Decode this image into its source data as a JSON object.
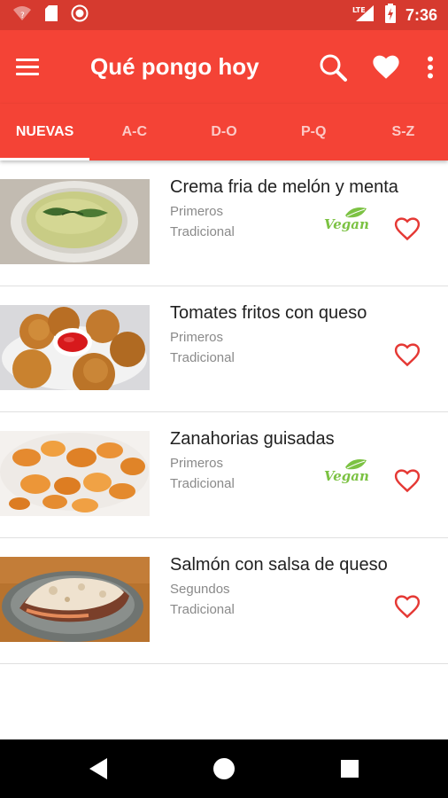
{
  "status_bar": {
    "time": "7:36",
    "network_label": "LTE",
    "icons": [
      "wifi-question-icon",
      "sd-card-icon",
      "record-icon",
      "cell-signal-icon",
      "battery-charging-icon"
    ]
  },
  "app_bar": {
    "title": "Qué pongo hoy",
    "icons": [
      "menu-icon",
      "search-icon",
      "heart-icon",
      "more-vert-icon"
    ]
  },
  "tabs": [
    {
      "label": "NUEVAS",
      "active": true
    },
    {
      "label": "A-C",
      "active": false
    },
    {
      "label": "D-O",
      "active": false
    },
    {
      "label": "P-Q",
      "active": false
    },
    {
      "label": "S-Z",
      "active": false
    }
  ],
  "recipes": [
    {
      "title": "Crema fria de melón y menta",
      "course": "Primeros",
      "style": "Tradicional",
      "vegan": true,
      "vegan_label": "Vegan",
      "image": "melon-cream-photo"
    },
    {
      "title": "Tomates fritos con queso",
      "course": "Primeros",
      "style": "Tradicional",
      "vegan": false,
      "image": "fried-tomatoes-photo"
    },
    {
      "title": "Zanahorias guisadas",
      "course": "Primeros",
      "style": "Tradicional",
      "vegan": true,
      "vegan_label": "Vegan",
      "image": "stewed-carrots-photo"
    },
    {
      "title": "Salmón con salsa de queso",
      "course": "Segundos",
      "style": "Tradicional",
      "vegan": false,
      "image": "salmon-cheese-sauce-photo"
    }
  ],
  "nav_bar": {
    "icons": [
      "back-icon",
      "home-icon",
      "recents-icon"
    ]
  },
  "colors": {
    "status_bar": "#d63a2f",
    "primary": "#f44336",
    "heart_outline": "#e53935",
    "vegan_green": "#7cc243",
    "title_text": "#212121",
    "secondary_text": "#8a8a8a"
  }
}
